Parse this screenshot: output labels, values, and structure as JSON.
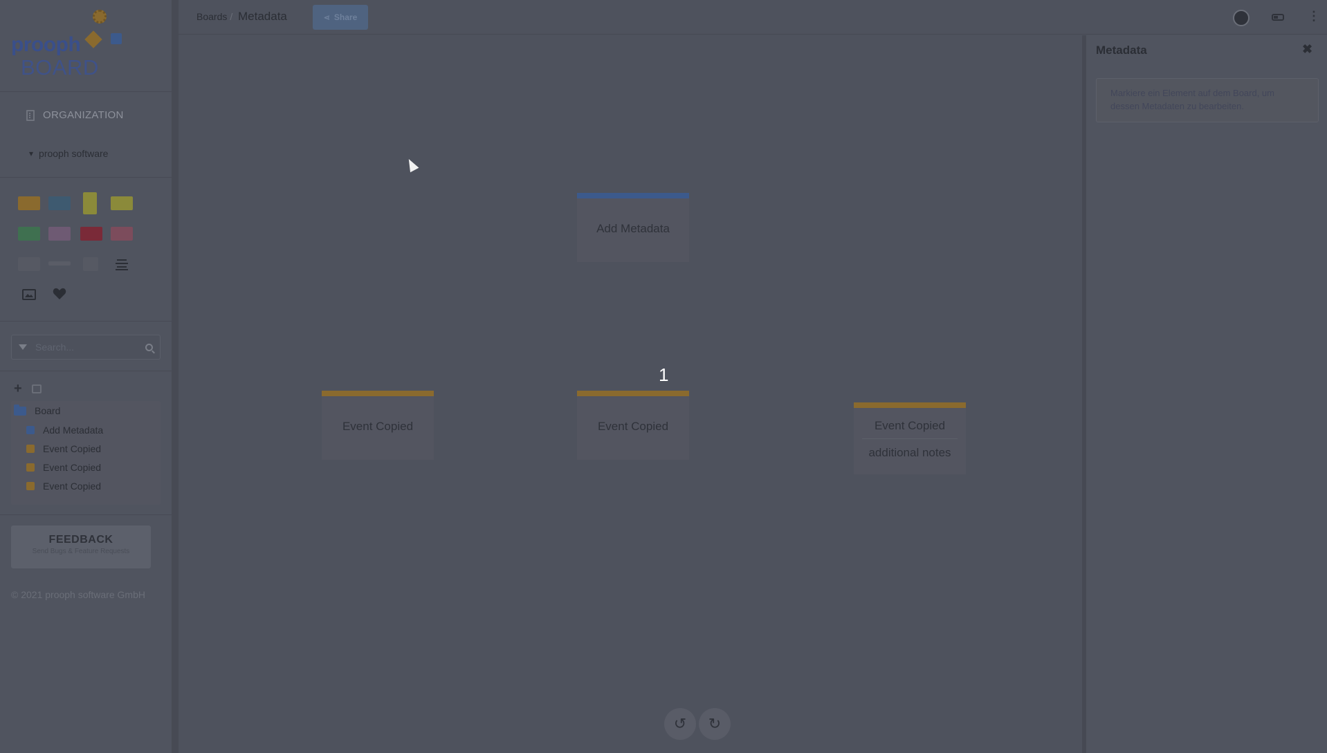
{
  "app": {
    "logo_text": "prooph",
    "logo_sub": "BOARD"
  },
  "sidebar": {
    "organization_label": "ORGANIZATION",
    "org_item": "prooph software",
    "swatches": [
      {
        "name": "event-swatch",
        "color": "#8a6a2e"
      },
      {
        "name": "command-swatch",
        "color": "#3e5a70"
      },
      {
        "name": "policy-swatch",
        "color": "#8b8a3a"
      },
      {
        "name": "aggregate-swatch",
        "color": "#8b8a3a"
      },
      {
        "name": "document-swatch",
        "color": "#3f7050"
      },
      {
        "name": "role-swatch",
        "color": "#6e5a73"
      },
      {
        "name": "error-swatch",
        "color": "#7a2a38"
      },
      {
        "name": "hotspot-swatch",
        "color": "#7c4c5c"
      },
      {
        "name": "note-swatch",
        "color": "#565963"
      },
      {
        "name": "line-swatch",
        "color": "#5a5d67"
      },
      {
        "name": "text-swatch",
        "color": "#565963"
      }
    ],
    "search_placeholder": "Search...",
    "tree": {
      "root_label": "Board",
      "items": [
        {
          "label": "Add Metadata",
          "color": "#3c5a8c"
        },
        {
          "label": "Event Copied",
          "color": "#8a6a2e"
        },
        {
          "label": "Event Copied",
          "color": "#8a6a2e"
        },
        {
          "label": "Event Copied",
          "color": "#8a6a2e"
        }
      ]
    },
    "feedback_title": "FEEDBACK",
    "feedback_sub": "Send Bugs & Feature Requests",
    "copyright": "© 2021 prooph software GmbH"
  },
  "topbar": {
    "breadcrumb": "Boards",
    "title": "Metadata",
    "share_label": "Share"
  },
  "canvas": {
    "cards": [
      {
        "label": "Add Metadata",
        "color": "#3c5a8c"
      },
      {
        "label": "Event Copied",
        "color": "#8a6a2e"
      },
      {
        "label": "Event Copied",
        "color": "#8a6a2e"
      },
      {
        "label": "Event Copied",
        "sub": "additional notes",
        "color": "#8a6a2e"
      }
    ],
    "badge": "1"
  },
  "panel": {
    "title": "Metadata",
    "info": "Markiere ein Element auf dem Board, um dessen Metadaten zu bearbeiten."
  }
}
